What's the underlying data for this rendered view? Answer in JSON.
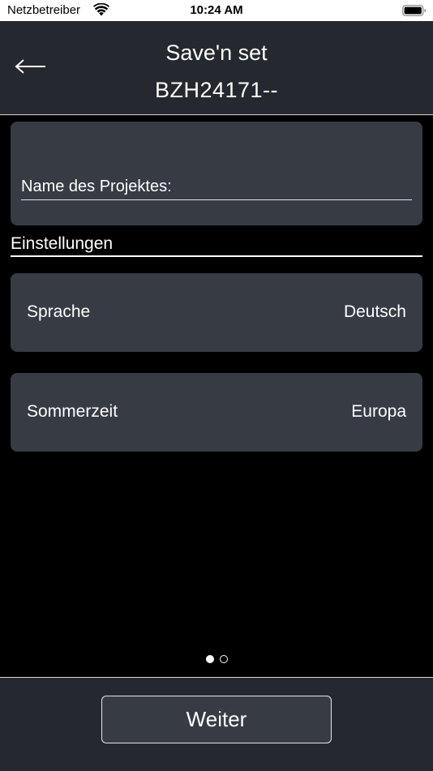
{
  "status_bar": {
    "carrier": "Netzbetreiber",
    "time": "10:24 AM",
    "wifi_icon": "wifi-icon",
    "battery_icon": "battery-full-icon"
  },
  "header": {
    "back_icon": "arrow-left-icon",
    "title": "Save'n set",
    "subtitle": "BZH24171--"
  },
  "project": {
    "label": "Name des Projektes:",
    "value": "",
    "placeholder": ""
  },
  "settings": {
    "heading": "Einstellungen",
    "items": [
      {
        "label": "Sprache",
        "value": "Deutsch"
      },
      {
        "label": "Sommerzeit",
        "value": "Europa"
      }
    ]
  },
  "pagination": {
    "total": 2,
    "current": 1
  },
  "footer": {
    "next_label": "Weiter"
  },
  "colors": {
    "background": "#000000",
    "bar": "#25282e",
    "card": "#373b44",
    "text": "#ffffff"
  }
}
